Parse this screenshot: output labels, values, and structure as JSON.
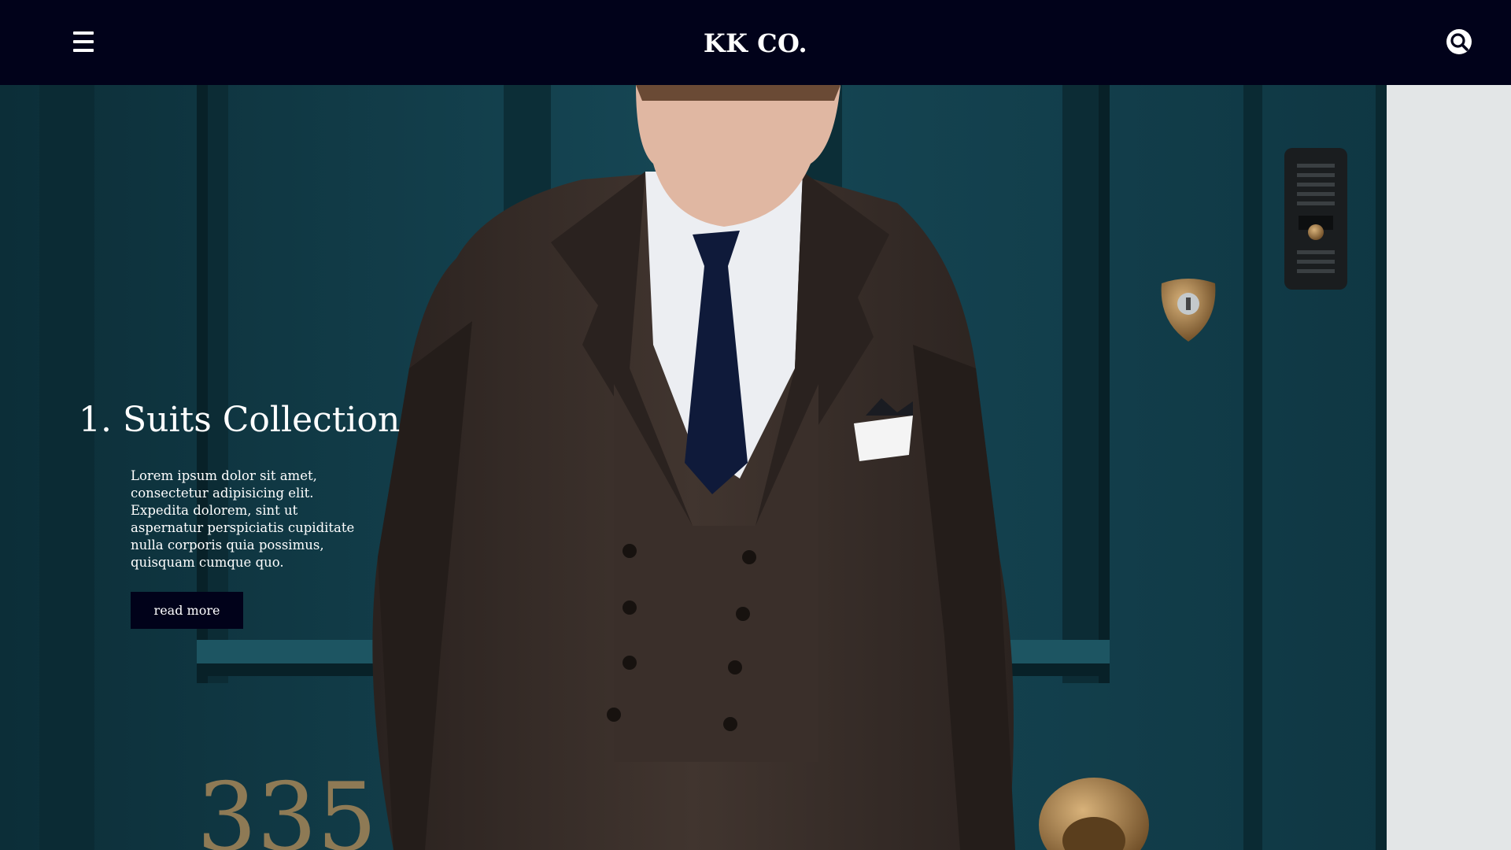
{
  "header": {
    "brand": "KK CO.",
    "menu_icon": "hamburger-menu-icon",
    "search_icon": "search-icon"
  },
  "hero": {
    "title": "1. Suits Collection",
    "body": "Lorem ipsum dolor sit amet, consectetur adipisicing elit. Expedita dolorem, sint ut aspernatur perspiciatis cupiditate nulla corporis quia possimus, quisquam cumque quo.",
    "cta_label": "read more",
    "door_number": "335"
  },
  "colors": {
    "navbar": "#01021a",
    "door": "#123d48",
    "suit": "#3b302b",
    "tie": "#0f1a3a",
    "text": "#ffffff"
  }
}
